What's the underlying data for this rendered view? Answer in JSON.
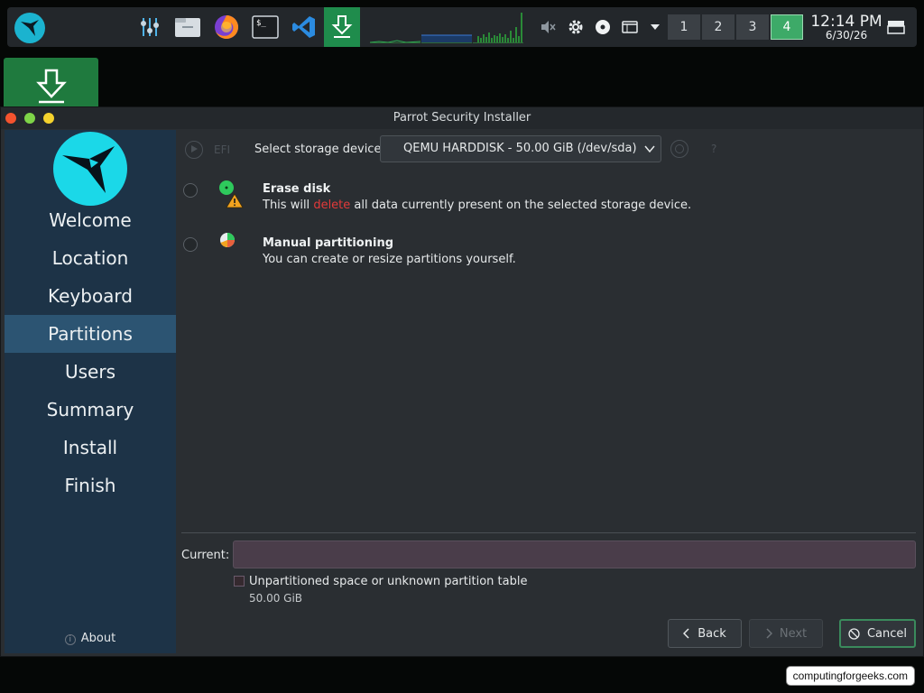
{
  "window": {
    "title": "Parrot Security Installer"
  },
  "panel": {
    "launchers": [
      "settings-sliders-icon",
      "file-manager-icon",
      "firefox-icon",
      "terminal-icon",
      "vscode-icon",
      "installer-icon"
    ],
    "workspaces": [
      "1",
      "2",
      "3",
      "4"
    ],
    "active_workspace": "4",
    "clock": {
      "time": "12:14 PM",
      "date": "6/30/26"
    }
  },
  "sidebar": {
    "steps": [
      "Welcome",
      "Location",
      "Keyboard",
      "Partitions",
      "Users",
      "Summary",
      "Install",
      "Finish"
    ],
    "current": "Partitions",
    "about": "About"
  },
  "partitions": {
    "efi_label": "EFI",
    "storage_label": "Select storage device:",
    "storage_value": "QEMU HARDDISK - 50.00 GiB (/dev/sda)",
    "help": "?",
    "options": [
      {
        "title": "Erase disk",
        "desc_before": "This will ",
        "desc_highlight": "delete",
        "desc_after": " all data currently present on the selected storage device."
      },
      {
        "title": "Manual partitioning",
        "desc": "You can create or resize partitions yourself."
      }
    ],
    "current_label": "Current:",
    "unpartitioned_label": "Unpartitioned space or unknown partition table",
    "unpartitioned_size": "50.00 GiB"
  },
  "buttons": {
    "back": "Back",
    "next": "Next",
    "cancel": "Cancel"
  },
  "watermark": "computingforgeeks.com",
  "colors": {
    "accent": "#1f8c4c",
    "sidebar": "#1d3347",
    "sidebar_current": "#2c5472",
    "delete": "#e33a3a"
  }
}
